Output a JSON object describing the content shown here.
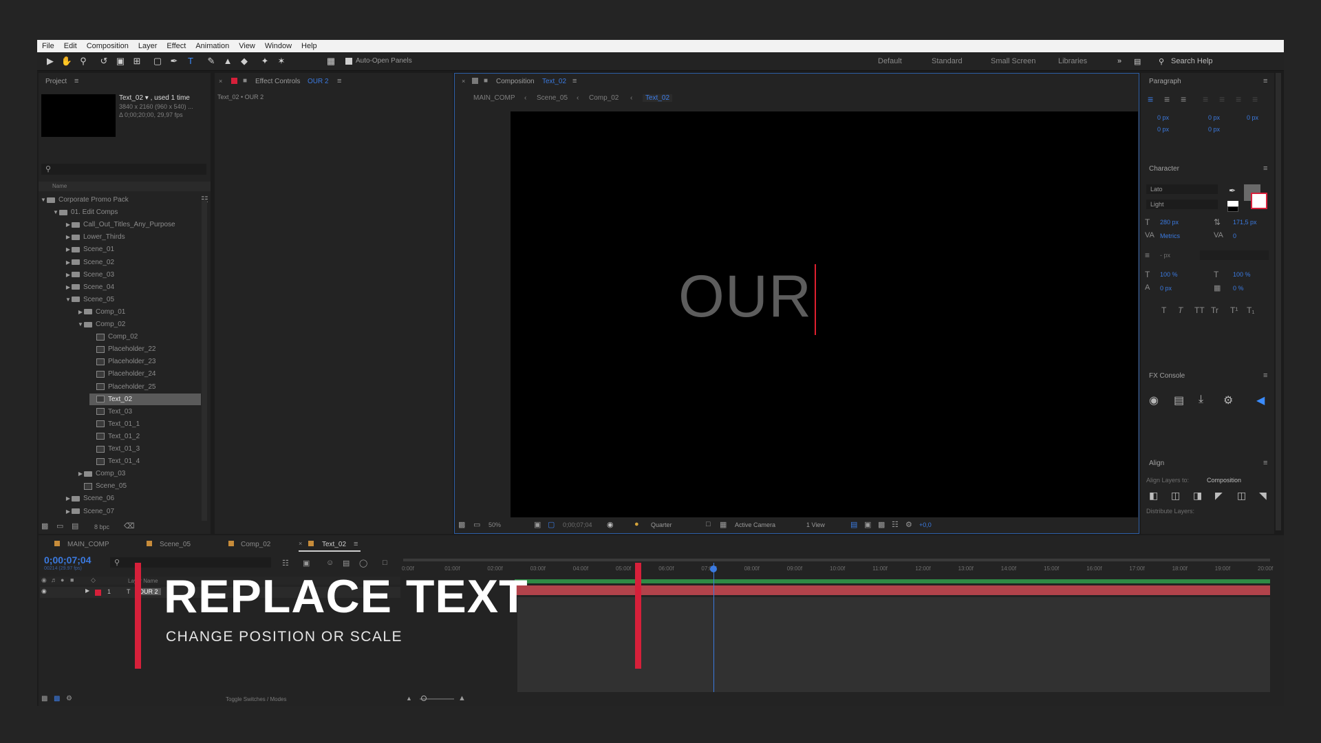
{
  "menu": [
    "File",
    "Edit",
    "Composition",
    "Layer",
    "Effect",
    "Animation",
    "View",
    "Window",
    "Help"
  ],
  "toolbar": {
    "auto_open_label": "Auto-Open Panels",
    "workspaces": [
      "Default",
      "Standard",
      "Small Screen",
      "Libraries"
    ],
    "search_help": "Search Help"
  },
  "project": {
    "title": "Project",
    "item_name": "Text_02 ▾ , used 1 time",
    "item_res": "3840 x 2160 (960 x 540) ...",
    "item_dur": "Δ 0;00;20;00, 29,97 fps",
    "col_name": "Name",
    "bpc": "8 bpc",
    "tree": [
      {
        "label": "Corporate Promo Pack",
        "indent": 0,
        "type": "folder",
        "tw": "▼"
      },
      {
        "label": "01. Edit Comps",
        "indent": 1,
        "type": "folder",
        "tw": "▼"
      },
      {
        "label": "Call_Out_Titles_Any_Purpose",
        "indent": 2,
        "type": "folder",
        "tw": "▶"
      },
      {
        "label": "Lower_Thirds",
        "indent": 2,
        "type": "folder",
        "tw": "▶"
      },
      {
        "label": "Scene_01",
        "indent": 2,
        "type": "folder",
        "tw": "▶"
      },
      {
        "label": "Scene_02",
        "indent": 2,
        "type": "folder",
        "tw": "▶"
      },
      {
        "label": "Scene_03",
        "indent": 2,
        "type": "folder",
        "tw": "▶"
      },
      {
        "label": "Scene_04",
        "indent": 2,
        "type": "folder",
        "tw": "▶"
      },
      {
        "label": "Scene_05",
        "indent": 2,
        "type": "folder",
        "tw": "▼"
      },
      {
        "label": "Comp_01",
        "indent": 3,
        "type": "folder",
        "tw": "▶"
      },
      {
        "label": "Comp_02",
        "indent": 3,
        "type": "folder",
        "tw": "▼"
      },
      {
        "label": "Comp_02",
        "indent": 4,
        "type": "comp",
        "tw": ""
      },
      {
        "label": "Placeholder_22",
        "indent": 4,
        "type": "comp",
        "tw": ""
      },
      {
        "label": "Placeholder_23",
        "indent": 4,
        "type": "comp",
        "tw": ""
      },
      {
        "label": "Placeholder_24",
        "indent": 4,
        "type": "comp",
        "tw": ""
      },
      {
        "label": "Placeholder_25",
        "indent": 4,
        "type": "comp",
        "tw": ""
      },
      {
        "label": "Text_02",
        "indent": 4,
        "type": "comp",
        "tw": "",
        "selected": true
      },
      {
        "label": "Text_03",
        "indent": 4,
        "type": "comp",
        "tw": ""
      },
      {
        "label": "Text_01_1",
        "indent": 4,
        "type": "comp",
        "tw": ""
      },
      {
        "label": "Text_01_2",
        "indent": 4,
        "type": "comp",
        "tw": ""
      },
      {
        "label": "Text_01_3",
        "indent": 4,
        "type": "comp",
        "tw": ""
      },
      {
        "label": "Text_01_4",
        "indent": 4,
        "type": "comp",
        "tw": ""
      },
      {
        "label": "Comp_03",
        "indent": 3,
        "type": "folder",
        "tw": "▶"
      },
      {
        "label": "Scene_05",
        "indent": 3,
        "type": "comp",
        "tw": ""
      },
      {
        "label": "Scene_06",
        "indent": 2,
        "type": "folder",
        "tw": "▶"
      },
      {
        "label": "Scene_07",
        "indent": 2,
        "type": "folder",
        "tw": "▶"
      }
    ]
  },
  "effect_controls": {
    "title": "Effect Controls",
    "layer": "OUR 2",
    "path": "Text_02 • OUR 2"
  },
  "composition": {
    "title": "Composition",
    "name": "Text_02",
    "breadcrumbs": [
      "MAIN_COMP",
      "Scene_05",
      "Comp_02",
      "Text_02"
    ],
    "viewer_text": "OUR",
    "zoom": "50%",
    "timecode": "0;00;07;04",
    "resolution": "Quarter",
    "camera": "Active Camera",
    "views": "1 View",
    "exposure": "+0,0"
  },
  "paragraph": {
    "title": "Paragraph",
    "values": [
      "0 px",
      "0 px",
      "0 px",
      "0 px",
      "0 px"
    ]
  },
  "character": {
    "title": "Character",
    "font": "Lato",
    "style": "Light",
    "size": "280 px",
    "leading": "171,5 px",
    "kerning": "Metrics",
    "tracking": "0",
    "stroke": "- px",
    "vscale": "100 %",
    "hscale": "100 %",
    "baseline": "0 px",
    "tsume": "0 %",
    "style_buttons": [
      "T",
      "T",
      "TT",
      "Tr",
      "T¹",
      "T₁"
    ]
  },
  "fx_console": {
    "title": "FX Console"
  },
  "align": {
    "title": "Align",
    "align_to_label": "Align Layers to:",
    "align_to": "Composition",
    "distribute_label": "Distribute Layers:"
  },
  "timeline": {
    "tabs": [
      "MAIN_COMP",
      "Scene_05",
      "Comp_02",
      "Text_02"
    ],
    "timecode": "0;00;07;04",
    "timecode_sub": "00214 (29.97 fps)",
    "layer_num": "1",
    "layer_name": "OUR 2",
    "col_label": "Layer Name",
    "toggle": "Toggle Switches / Modes",
    "ruler": [
      "0:00f",
      "01:00f",
      "02:00f",
      "03:00f",
      "04:00f",
      "05:00f",
      "06:00f",
      "07:00f",
      "08:00f",
      "09:00f",
      "10:00f",
      "11:00f",
      "12:00f",
      "13:00f",
      "14:00f",
      "15:00f",
      "16:00f",
      "17:00f",
      "18:00f",
      "19:00f",
      "20:00f"
    ]
  },
  "overlay": {
    "title": "REPLACE TEXT",
    "subtitle": "CHANGE POSITION OR SCALE"
  },
  "colors": {
    "accent_blue": "#3b7ae0",
    "accent_red": "#d6203a",
    "layer_bar": "#b2434b",
    "workarea_green": "#2f8a45"
  }
}
